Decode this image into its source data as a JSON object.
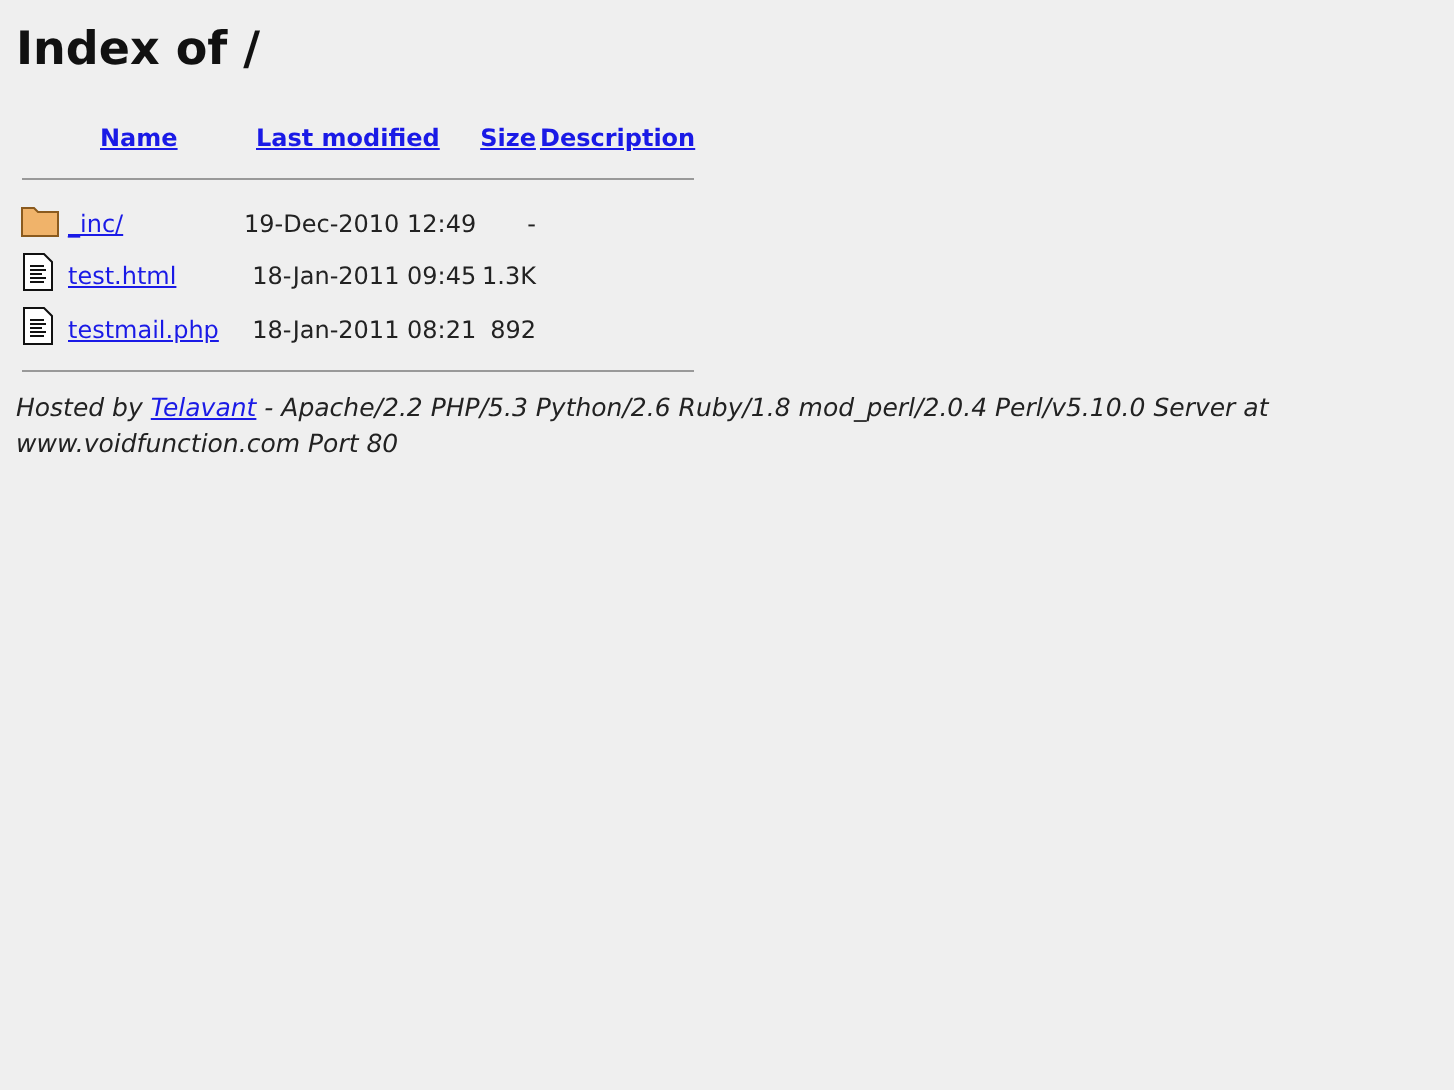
{
  "heading": "Index of /",
  "columns": [
    "Name",
    "Last modified",
    "Size",
    "Description"
  ],
  "rows": [
    {
      "kind": "folder",
      "name": "_inc/",
      "modified": "19-Dec-2010 12:49",
      "size": "-"
    },
    {
      "kind": "file",
      "name": "test.html",
      "modified": "18-Jan-2011 09:45",
      "size": "1.3K"
    },
    {
      "kind": "file",
      "name": "testmail.php",
      "modified": "18-Jan-2011 08:21",
      "size": "892"
    }
  ],
  "footer": {
    "prefix": "Hosted by",
    "link": "Telavant",
    "suffix": "- Apache/2.2 PHP/5.3 Python/2.6 Ruby/1.8 mod_perl/2.0.4 Perl/v5.10.0 Server at www.voidfunction.com Port 80"
  }
}
